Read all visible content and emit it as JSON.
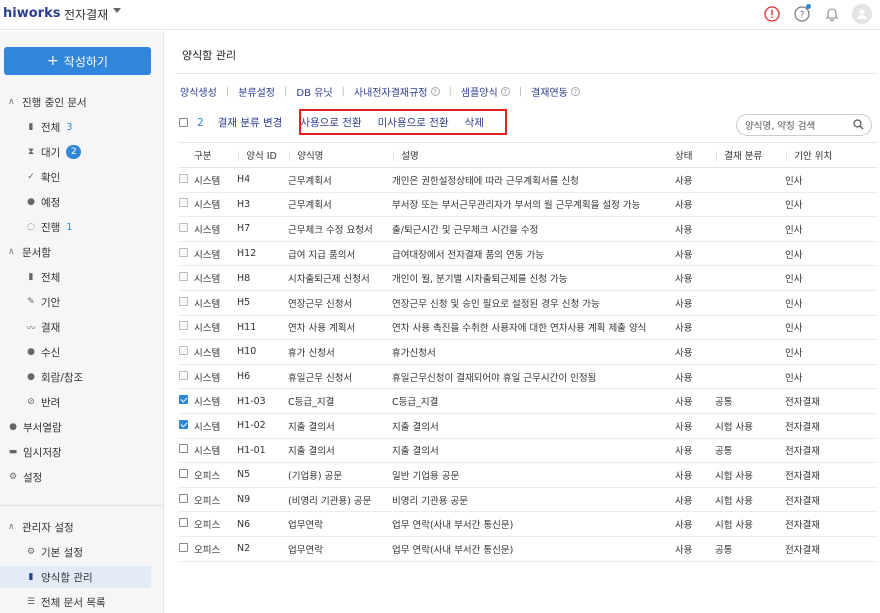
{
  "app": {
    "logo": "hiworks",
    "title": "전자결재"
  },
  "sidebar": {
    "compose_label": "작성하기",
    "groups": [
      {
        "label": "진행 중인 문서"
      },
      {
        "label": "문서함"
      },
      {
        "label": "관리자 설정"
      }
    ],
    "in_progress": [
      {
        "label": "전체",
        "count": "3"
      },
      {
        "label": "대기",
        "count": "2"
      },
      {
        "label": "확인"
      },
      {
        "label": "예정"
      },
      {
        "label": "진행",
        "count": "1"
      }
    ],
    "docbox": [
      {
        "label": "전체"
      },
      {
        "label": "기안"
      },
      {
        "label": "결재"
      },
      {
        "label": "수신"
      },
      {
        "label": "회람/참조"
      },
      {
        "label": "반려"
      }
    ],
    "extra": [
      {
        "label": "부서열람"
      },
      {
        "label": "임시저장"
      },
      {
        "label": "설정"
      }
    ],
    "admin": [
      {
        "label": "기본 설정"
      },
      {
        "label": "양식함 관리"
      },
      {
        "label": "전체 문서 목록"
      }
    ]
  },
  "main": {
    "page_title": "양식함 관리",
    "tabs": [
      {
        "label": "양식생성"
      },
      {
        "label": "분류설정"
      },
      {
        "label": "DB 유닛"
      },
      {
        "label": "사내전자결재규정"
      },
      {
        "label": "샘플양식"
      },
      {
        "label": "결재연동"
      }
    ],
    "actions": {
      "selected_count": "2",
      "change_category": "결재 분류 변경",
      "to_use": "사용으로 전환",
      "to_unused": "미사용으로 전환",
      "delete": "삭제"
    },
    "search": {
      "placeholder": "양식명, 약칭 검색"
    },
    "table": {
      "headers": [
        "구분",
        "양식 ID",
        "양식명",
        "설명",
        "상태",
        "결재 분류",
        "기안 위치"
      ],
      "rows": [
        {
          "type": "시스템",
          "id": "H4",
          "name": "근무계획서",
          "desc": "개인은 권한설정상태에 따라 근무계획서를 신청",
          "status": "사용",
          "category": "",
          "location": "인사",
          "check": "disabled"
        },
        {
          "type": "시스템",
          "id": "H3",
          "name": "근무계획서",
          "desc": "부서장 또는 부서근무관리자가 부서의 월 근무계획을 설정 가능",
          "status": "사용",
          "category": "",
          "location": "인사",
          "check": "disabled"
        },
        {
          "type": "시스템",
          "id": "H7",
          "name": "근무체크 수정 요청서",
          "desc": "출/퇴근시간 및 근무체크 시간을 수정",
          "status": "사용",
          "category": "",
          "location": "인사",
          "check": "disabled"
        },
        {
          "type": "시스템",
          "id": "H12",
          "name": "급여 지급 품의서",
          "desc": "급여대장에서 전자결재 품의 연동 가능",
          "status": "사용",
          "category": "",
          "location": "인사",
          "check": "disabled"
        },
        {
          "type": "시스템",
          "id": "H8",
          "name": "시차출퇴근제 신청서",
          "desc": "개인이 월, 분기별 시차출퇴근제를 신청 가능",
          "status": "사용",
          "category": "",
          "location": "인사",
          "check": "disabled"
        },
        {
          "type": "시스템",
          "id": "H5",
          "name": "연장근무 신청서",
          "desc": "연장근무 신청 및 승인 필요로 설정된 경우 신청 가능",
          "status": "사용",
          "category": "",
          "location": "인사",
          "check": "disabled"
        },
        {
          "type": "시스템",
          "id": "H11",
          "name": "연차 사용 계획서",
          "desc": "연차 사용 촉진을 수취한 사용자에 대한 연차사용 계획 제출 양식",
          "status": "사용",
          "category": "",
          "location": "인사",
          "check": "disabled"
        },
        {
          "type": "시스템",
          "id": "H10",
          "name": "휴가 신청서",
          "desc": "휴가신청서",
          "status": "사용",
          "category": "",
          "location": "인사",
          "check": "disabled"
        },
        {
          "type": "시스템",
          "id": "H6",
          "name": "휴일근무 신청서",
          "desc": "휴일근무신청이 결재되어야 휴일 근무시간이 인정됨",
          "status": "사용",
          "category": "",
          "location": "인사",
          "check": "disabled"
        },
        {
          "type": "시스템",
          "id": "H1-03",
          "name": "C등급_지결",
          "desc": "C등급_지결",
          "status": "사용",
          "category": "공통",
          "location": "전자결재",
          "check": "checked"
        },
        {
          "type": "시스템",
          "id": "H1-02",
          "name": "지출 결의서",
          "desc": "지출 결의서",
          "status": "사용",
          "category": "시험 사용",
          "location": "전자결재",
          "check": "checked"
        },
        {
          "type": "시스템",
          "id": "H1-01",
          "name": "지출 결의서",
          "desc": "지출 결의서",
          "status": "사용",
          "category": "공통",
          "location": "전자결재",
          "check": "unchecked"
        },
        {
          "type": "오피스",
          "id": "N5",
          "name": "(기업용) 공문",
          "desc": "일반 기업용 공문",
          "status": "사용",
          "category": "시험 사용",
          "location": "전자결재",
          "check": "unchecked"
        },
        {
          "type": "오피스",
          "id": "N9",
          "name": "(비영리 기관용) 공문",
          "desc": "비영리 기관용 공문",
          "status": "사용",
          "category": "시험 사용",
          "location": "전자결재",
          "check": "unchecked"
        },
        {
          "type": "오피스",
          "id": "N6",
          "name": "업무연락",
          "desc": "업무 연락(사내 부서간 통신문)",
          "status": "사용",
          "category": "시험 사용",
          "location": "전자결재",
          "check": "unchecked"
        },
        {
          "type": "오피스",
          "id": "N2",
          "name": "업무연락",
          "desc": "업무 연락(사내 부서간 통신문)",
          "status": "사용",
          "category": "공통",
          "location": "전자결재",
          "check": "unchecked"
        }
      ]
    }
  },
  "colors": {
    "accent": "#2f86db",
    "navy": "#2e3e8f",
    "status_red": "#d0402d",
    "highlight_box": "#e01f1f"
  }
}
